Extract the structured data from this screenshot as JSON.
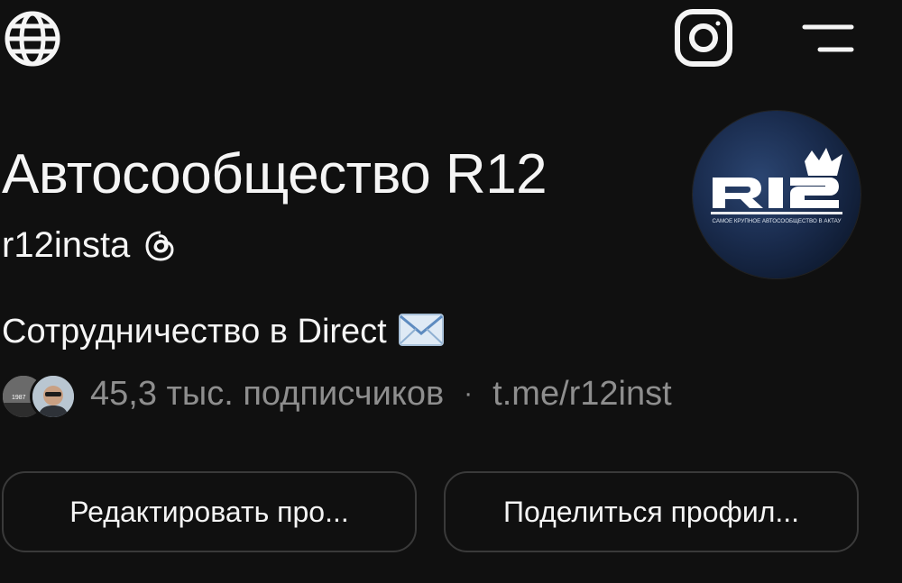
{
  "header": {
    "icons": [
      "globe-icon",
      "instagram-icon",
      "menu-icon"
    ]
  },
  "profile": {
    "name": "Автосообщество R12",
    "username": "r12insta",
    "bio": "Сотрудничество в Direct",
    "bio_emoji": "✉️",
    "followers": "45,3 тыс. подписчиков",
    "separator": "·",
    "link": "t.me/r12inst",
    "avatar": {
      "logo_text": "R12",
      "tagline": "САМОЕ КРУПНОЕ АВТОСООБЩЕСТВО В АКТАУ"
    },
    "mini_avatar_text": "1987"
  },
  "actions": {
    "edit_label": "Редактировать про...",
    "share_label": "Поделиться профил..."
  },
  "colors": {
    "background": "#101010",
    "text_primary": "#f5f5f5",
    "text_secondary": "#8e8e8e",
    "button_border": "#3a3a3a"
  }
}
